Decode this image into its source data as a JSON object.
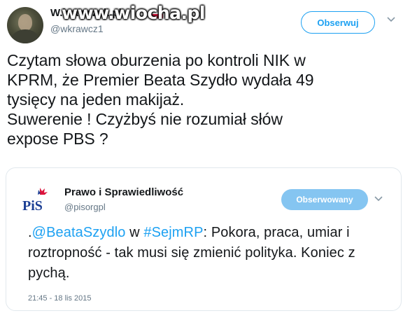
{
  "author": {
    "display_name": "W.krawczyk.pl",
    "handle": "@wkrawcz1",
    "flag": "poland-flag-icon"
  },
  "watermark": "www.wiocha.pl",
  "follow_button": {
    "label": "Obserwuj"
  },
  "tweet": {
    "text": "Czytam słowa oburzenia po kontroli NIK w\nKPRM, że Premier Beata Szydło wydała 49\ntysięcy na jeden makijaż.\nSuwerenie !  Czyżbyś nie rozumiał słów\nexpose PBS ?"
  },
  "quoted": {
    "display_name": "Prawo i Sprawiedliwość",
    "handle": "@pisorgpl",
    "logo_text": "PiS",
    "follow_button": {
      "label": "Obserwowany"
    },
    "text_parts": {
      "prefix": ".",
      "mention": "@BeataSzydlo",
      "mid1": " w ",
      "hashtag": "#SejmRP",
      "rest": ": Pokora, praca, umiar i roztropność - tak musi się zmienić polityka. Koniec z pychą."
    },
    "timestamp": "21:45 - 18 lis 2015"
  },
  "colors": {
    "accent": "#1da1f2",
    "secondary_text": "#657786",
    "followed_button_bg": "#85c5f1",
    "pis_blue": "#1c3f94",
    "pis_red": "#dc143c"
  }
}
